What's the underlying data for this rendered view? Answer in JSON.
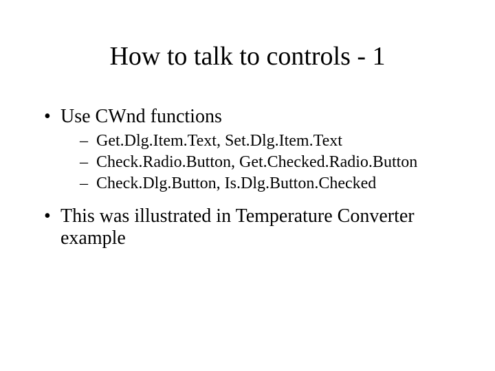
{
  "title": "How to talk to controls - 1",
  "bullets": [
    {
      "text": "Use CWnd functions",
      "sub": [
        "Get.Dlg.Item.Text, Set.Dlg.Item.Text",
        "Check.Radio.Button, Get.Checked.Radio.Button",
        "Check.Dlg.Button, Is.Dlg.Button.Checked"
      ]
    },
    {
      "text": "This was illustrated in Temperature Converter example",
      "sub": []
    }
  ]
}
